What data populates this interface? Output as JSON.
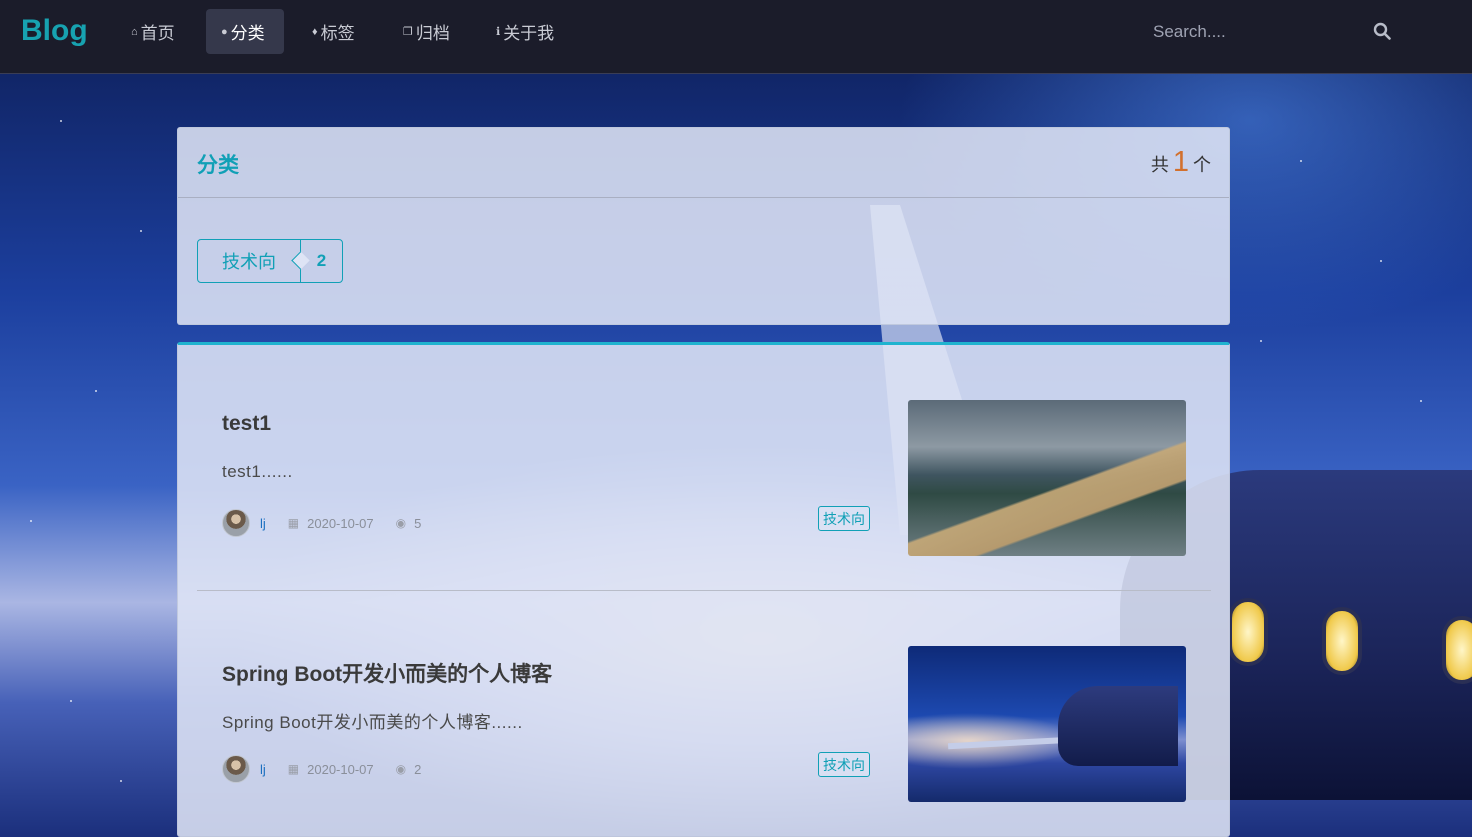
{
  "navbar": {
    "brand": "Blog",
    "items": [
      {
        "label": "首页",
        "icon": "home-icon",
        "active": false
      },
      {
        "label": "分类",
        "icon": "idea-icon",
        "active": true
      },
      {
        "label": "标签",
        "icon": "tags-icon",
        "active": false
      },
      {
        "label": "归档",
        "icon": "clone-icon",
        "active": false
      },
      {
        "label": "关于我",
        "icon": "info-icon",
        "active": false
      }
    ],
    "search_placeholder": "Search...."
  },
  "categories": {
    "title": "分类",
    "count_prefix": "共",
    "count": "1",
    "count_suffix": "个",
    "items": [
      {
        "name": "技术向",
        "count": "2"
      }
    ]
  },
  "posts": [
    {
      "title": "test1",
      "excerpt": "test1......",
      "author": "lj",
      "date": "2020-10-07",
      "views": "5",
      "tag": "技术向",
      "image": "beach-photo"
    },
    {
      "title": "Spring Boot开发小而美的个人博客",
      "excerpt": "Spring Boot开发小而美的个人博客......",
      "author": "lj",
      "date": "2020-10-07",
      "views": "2",
      "tag": "技术向",
      "image": "night-plane-illustration"
    }
  ],
  "colors": {
    "accent": "#11a0b6",
    "navbar_bg": "#1b1c2a",
    "count_highlight": "#d2702d"
  }
}
